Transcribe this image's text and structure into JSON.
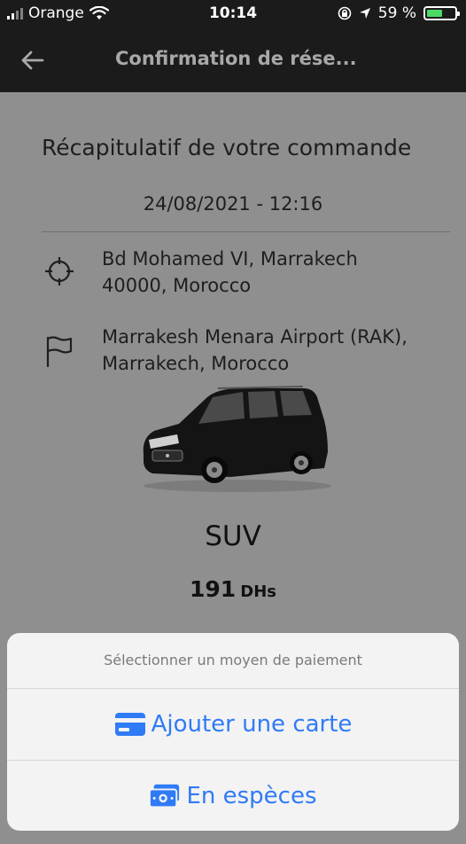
{
  "status_bar": {
    "carrier": "Orange",
    "time": "10:14",
    "battery_percent": "59 %",
    "battery_level": 0.59
  },
  "nav": {
    "title": "Confirmation de rése..."
  },
  "summary": {
    "title": "Récapitulatif de votre commande",
    "datetime": "24/08/2021 - 12:16",
    "pickup_line1": "Bd Mohamed VI, Marrakech",
    "pickup_line2": "40000, Morocco",
    "dropoff_line1": "Marrakesh Menara Airport (RAK),",
    "dropoff_line2": "Marrakech, Morocco",
    "vehicle_type": "SUV",
    "price_amount": "191",
    "price_currency": "DHs"
  },
  "payment_sheet": {
    "title": "Sélectionner un moyen de paiement",
    "add_card_label": "Ajouter une carte",
    "cash_label": "En espèces"
  },
  "colors": {
    "accent": "#2f7bf6",
    "header": "#1b1b1b",
    "overlay": "#8f8f8f"
  },
  "icons": [
    "signal-icon",
    "wifi-icon",
    "orientation-lock-icon",
    "location-arrow-icon",
    "battery-icon",
    "back-arrow-icon",
    "crosshair-icon",
    "flag-icon",
    "credit-card-icon",
    "cash-icon"
  ]
}
